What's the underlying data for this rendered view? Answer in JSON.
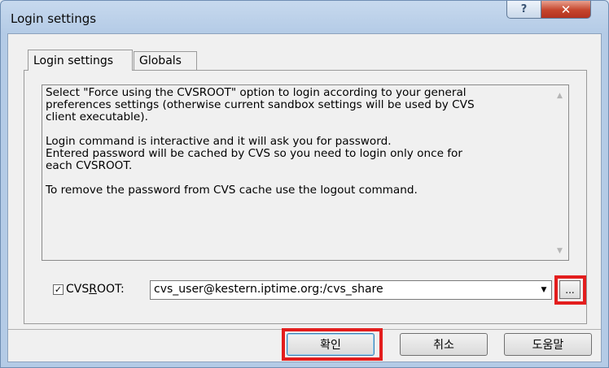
{
  "window": {
    "title": "Login settings",
    "help_glyph": "?",
    "close_glyph": "✕"
  },
  "tabs": [
    {
      "label": "Login settings",
      "active": true
    },
    {
      "label": "Globals",
      "active": false
    }
  ],
  "info": {
    "text": "Select \"Force using the CVSROOT\" option to login according to your general\npreferences settings (otherwise current sandbox settings will be used by CVS\nclient executable).\n\nLogin command is interactive and it will ask you for password.\nEntered password will be cached by CVS so you need to login only once for\neach CVSROOT.\n\nTo remove the password from CVS cache use the logout command."
  },
  "cvsroot": {
    "checked": true,
    "check_glyph": "✓",
    "label_prefix": "CVS",
    "label_underlined": "R",
    "label_suffix": "OOT:",
    "value": "cvs_user@kestern.iptime.org:/cvs_share",
    "browse_label": "..."
  },
  "buttons": {
    "ok": "확인",
    "cancel": "취소",
    "help": "도움말"
  },
  "highlight_color": "#e31d1d"
}
